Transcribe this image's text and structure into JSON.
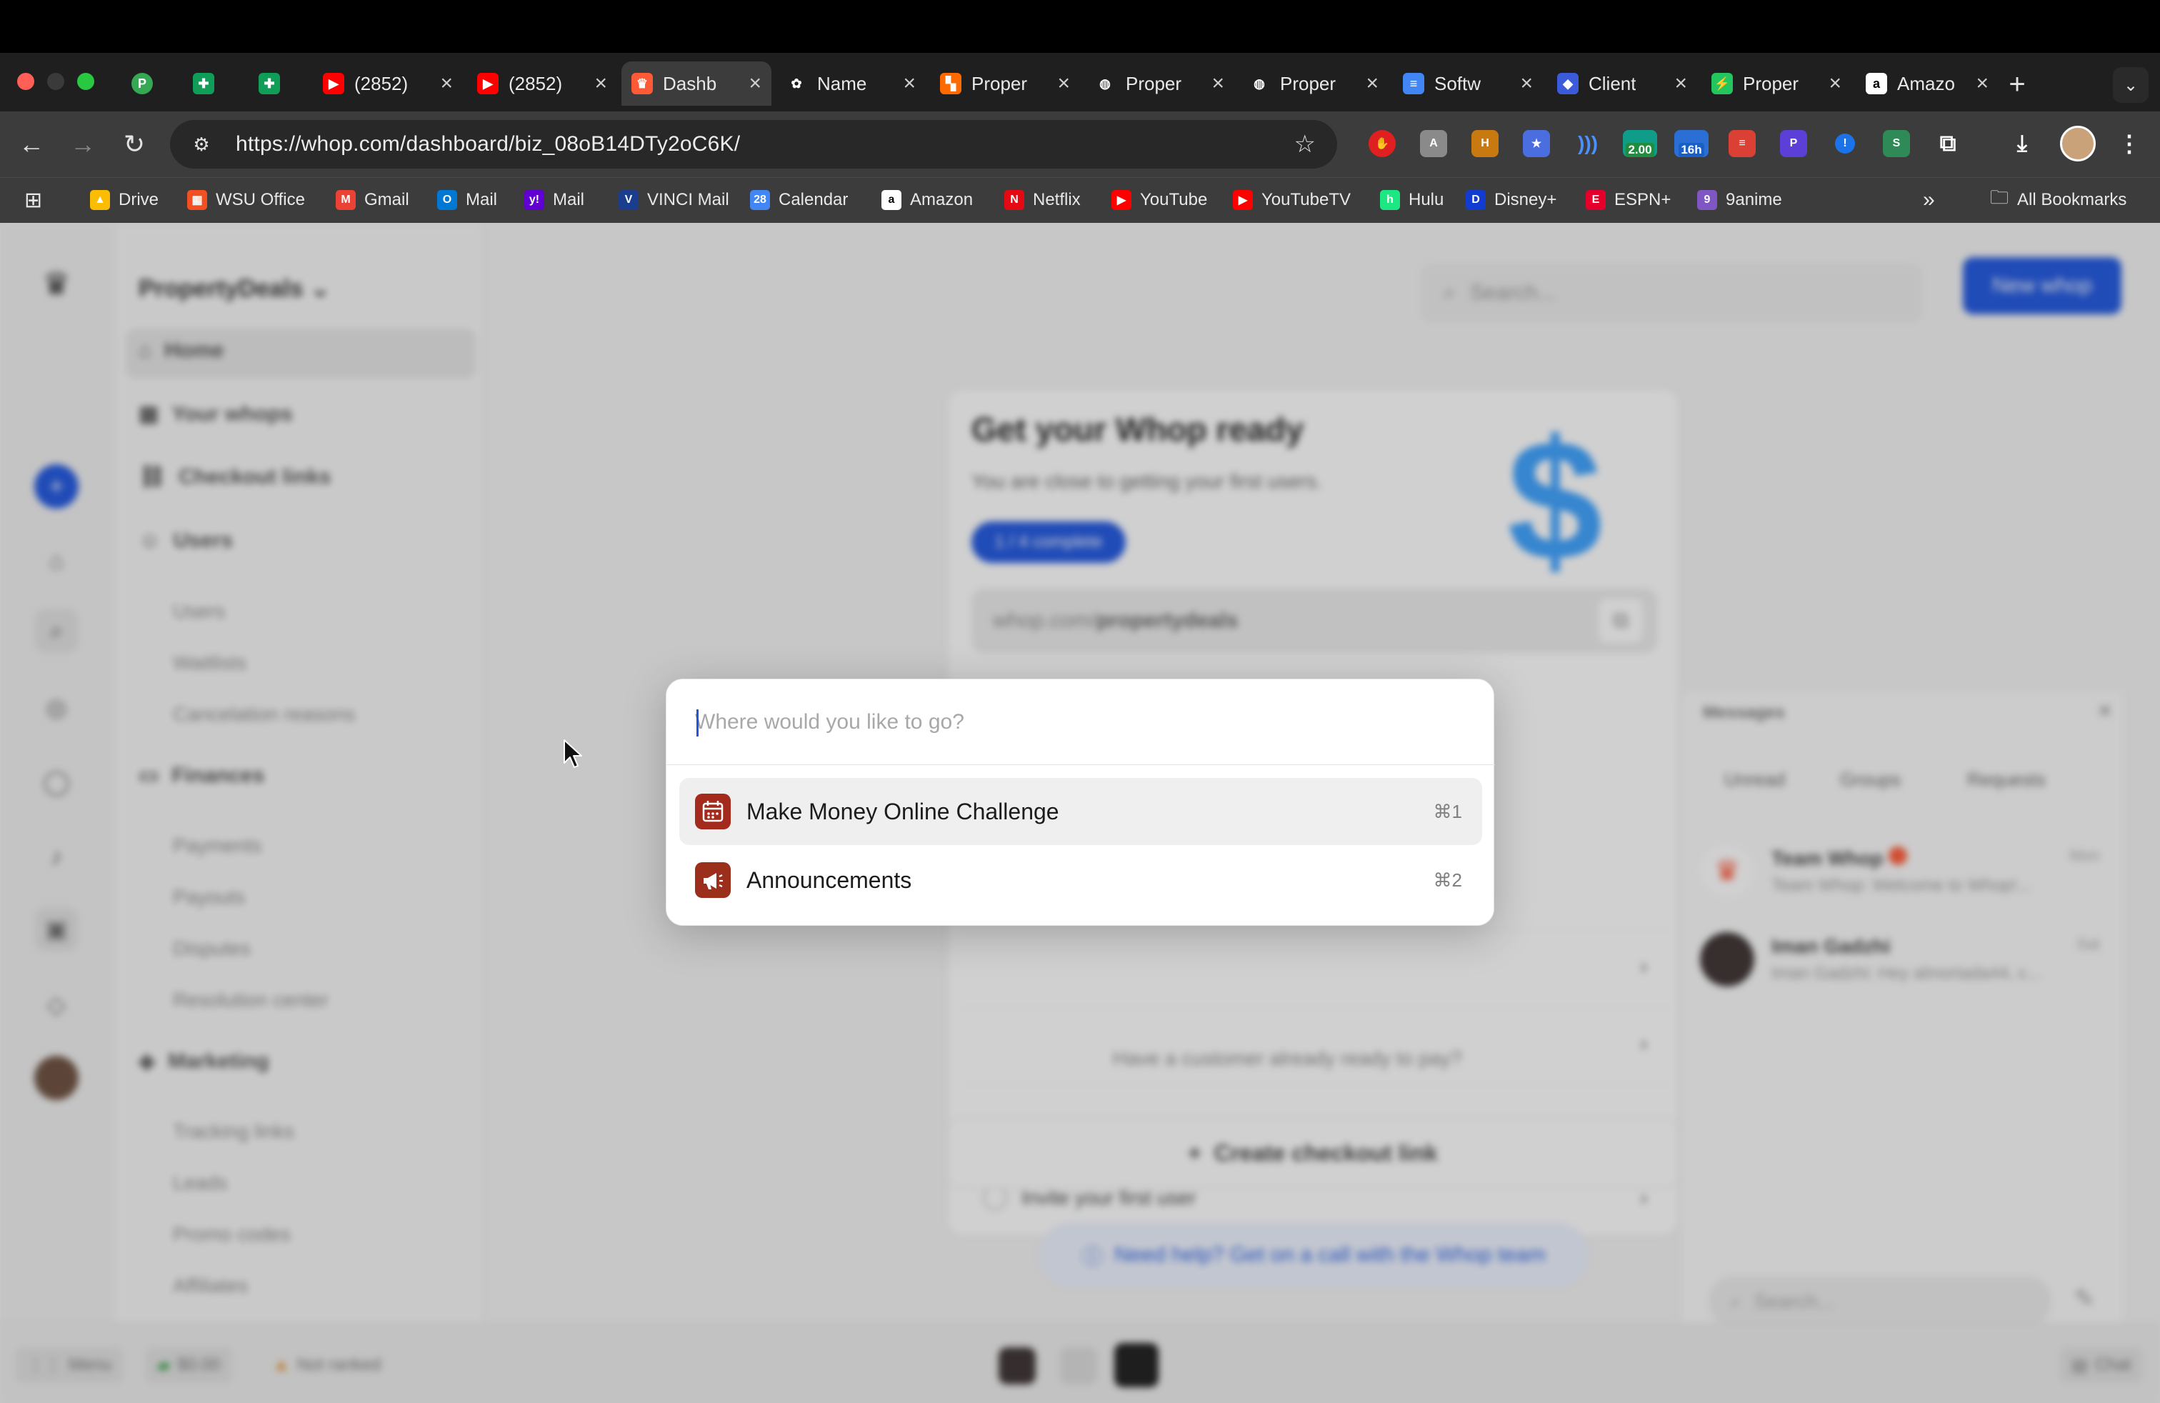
{
  "browser": {
    "tabs": [
      {
        "title": "",
        "icon": "green-p-icon",
        "color": "#34a853",
        "pinned": true
      },
      {
        "title": "",
        "icon": "sheets-icon",
        "color": "#0f9d58",
        "pinned": true
      },
      {
        "title": "",
        "icon": "sheets-icon",
        "color": "#0f9d58",
        "pinned": true
      },
      {
        "title": "(2852)",
        "icon": "youtube-icon",
        "color": "#ff0000"
      },
      {
        "title": "(2852)",
        "icon": "youtube-icon",
        "color": "#ff0000"
      },
      {
        "title": "Dashb",
        "icon": "whop-icon",
        "color": "#ff5a36",
        "active": true
      },
      {
        "title": "Name",
        "icon": "openai-icon",
        "color": "#1f1f1f"
      },
      {
        "title": "Proper",
        "icon": "property-icon",
        "color": "#ff6a00"
      },
      {
        "title": "Proper",
        "icon": "globe-icon",
        "color": "#1f1f1f"
      },
      {
        "title": "Proper",
        "icon": "globe-icon",
        "color": "#1f1f1f"
      },
      {
        "title": "Softw",
        "icon": "docs-icon",
        "color": "#4285f4"
      },
      {
        "title": "Client",
        "icon": "shield-icon",
        "color": "#3b5bdb"
      },
      {
        "title": "Proper",
        "icon": "pulse-icon",
        "color": "#22c55e"
      },
      {
        "title": "Amazo",
        "icon": "amazon-icon",
        "color": "#ffffff"
      }
    ],
    "url": "https://whop.com/dashboard/biz_08oB14DTy2oC6K/",
    "extension_badges": {
      "badge_1": "2.00",
      "badge_2": "16h"
    },
    "bookmarks": [
      {
        "label": "Drive",
        "icon": "drive-icon",
        "color": "#fbbc04"
      },
      {
        "label": "WSU Office",
        "icon": "microsoft-icon",
        "color": "#f25022"
      },
      {
        "label": "Gmail",
        "icon": "gmail-icon",
        "color": "#ea4335"
      },
      {
        "label": "Mail",
        "icon": "outlook-icon",
        "color": "#0078d4"
      },
      {
        "label": "Mail",
        "icon": "yahoo-icon",
        "color": "#6001d2"
      },
      {
        "label": "VINCI Mail",
        "icon": "vinci-icon",
        "color": "#1a3d8f"
      },
      {
        "label": "Calendar",
        "icon": "calendar-icon",
        "color": "#4285f4"
      },
      {
        "label": "Amazon",
        "icon": "amazon-icon",
        "color": "#ffffff"
      },
      {
        "label": "Netflix",
        "icon": "netflix-icon",
        "color": "#e50914"
      },
      {
        "label": "YouTube",
        "icon": "youtube-icon",
        "color": "#ff0000"
      },
      {
        "label": "YouTubeTV",
        "icon": "youtube-icon",
        "color": "#ff0000"
      },
      {
        "label": "Hulu",
        "icon": "hulu-icon",
        "color": "#1ce783"
      },
      {
        "label": "Disney+",
        "icon": "disney-icon",
        "color": "#113ccf"
      },
      {
        "label": "ESPN+",
        "icon": "espn-icon",
        "color": "#e4002b"
      },
      {
        "label": "9anime",
        "icon": "anime-icon",
        "color": "#7e57c2"
      }
    ],
    "all_bookmarks": "All Bookmarks"
  },
  "app": {
    "business_name": "PropertyDeals",
    "search_placeholder": "Search...",
    "new_whop": "New whop",
    "sidebar": {
      "home": "Home",
      "your_whops": "Your whops",
      "checkout_links": "Checkout links",
      "users": "Users",
      "users_sub": [
        "Users",
        "Waitlists",
        "Cancelation reasons"
      ],
      "finances": "Finances",
      "finances_sub": [
        "Payments",
        "Payouts",
        "Disputes",
        "Resolution center"
      ],
      "marketing": "Marketing",
      "marketing_sub": [
        "Tracking links",
        "Leads",
        "Promo codes",
        "Affiliates"
      ]
    },
    "onboarding": {
      "title": "Get your Whop ready",
      "subtitle": "You are close to getting your first users.",
      "progress": "1 / 4 complete",
      "store_url_prefix": "whop.com/",
      "store_url_slug": "propertydeals",
      "task_invite": "Invite your first user",
      "prompt": "Have a customer already ready to pay?",
      "create_checkout": "Create checkout link",
      "help_link": "Need help? Get on a call with the Whop team"
    },
    "messages": {
      "title": "Messages",
      "tabs": [
        "Unread",
        "Groups",
        "Requests"
      ],
      "threads": [
        {
          "name": "Team Whop",
          "time": "Mon",
          "preview": "Team Whop: Welcome to Whop!..."
        },
        {
          "name": "Iman Gadzhi",
          "time": "Sat",
          "preview": "Iman Gadzhi: Hey almortada44, c..."
        }
      ],
      "search_placeholder": "Search..."
    },
    "bottom_bar": {
      "menu": "Menu",
      "balance": "$0.00",
      "rank": "Not ranked",
      "chat": "Chat"
    }
  },
  "palette": {
    "placeholder": "Where would you like to go?",
    "items": [
      {
        "label": "Make Money Online Challenge",
        "shortcut": "⌘1",
        "icon": "calendar-icon",
        "color": "#c0392b",
        "selected": true
      },
      {
        "label": "Announcements",
        "shortcut": "⌘2",
        "icon": "megaphone-icon",
        "color": "#b03a1e",
        "selected": false
      }
    ]
  }
}
